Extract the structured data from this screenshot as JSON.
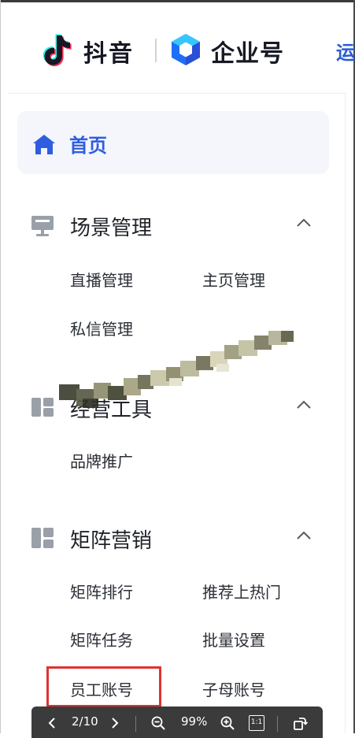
{
  "header": {
    "brand_douyin": "抖音",
    "brand_enterprise": "企业号",
    "cut_text": "运"
  },
  "sidebar": {
    "home_label": "首页",
    "sections": [
      {
        "title": "场景管理",
        "icon": "monitor-icon",
        "items": [
          "直播管理",
          "主页管理",
          "私信管理"
        ]
      },
      {
        "title": "经营工具",
        "icon": "tools-icon",
        "items": [
          "品牌推广"
        ]
      },
      {
        "title": "矩阵营销",
        "icon": "matrix-icon",
        "items": [
          "矩阵排行",
          "推荐上热门",
          "矩阵任务",
          "批量设置",
          "员工账号",
          "子母账号"
        ]
      }
    ]
  },
  "viewer": {
    "page": "2/10",
    "zoom": "99%",
    "actual_size_label": "1:1"
  },
  "colors": {
    "accent": "#2f5de0",
    "highlight": "#e03131",
    "viewer_bg": "#3b3b3b"
  }
}
